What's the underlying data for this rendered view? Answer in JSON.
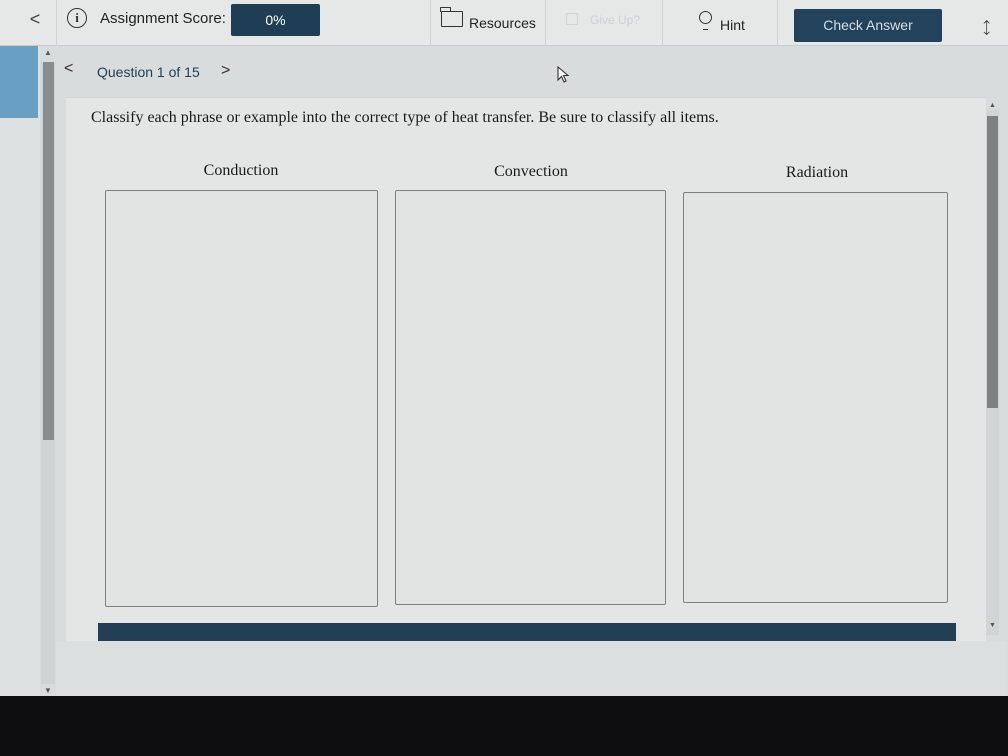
{
  "toolbar": {
    "back_glyph": "<",
    "score_label": "Assignment Score:",
    "score_value": "0%",
    "resources_label": "Resources",
    "give_up_label": "Give Up?",
    "hint_label": "Hint",
    "check_answer_label": "Check Answer",
    "info_glyph": "i",
    "collapse_glyph": "⤡"
  },
  "question_nav": {
    "prev_glyph": "<",
    "label": "Question 1 of 15",
    "next_glyph": ">"
  },
  "question": {
    "prompt": "Classify each phrase or example into the correct type of heat transfer. Be sure to classify all items.",
    "categories": [
      {
        "label": "Conduction"
      },
      {
        "label": "Convection"
      },
      {
        "label": "Radiation"
      }
    ]
  },
  "colors": {
    "primary_dark": "#1f3e56",
    "accent_blue": "#6a9fc4"
  },
  "icons": [
    "info-icon",
    "folder-icon",
    "flag-icon",
    "lightbulb-icon",
    "collapse-icon",
    "cursor-icon"
  ]
}
